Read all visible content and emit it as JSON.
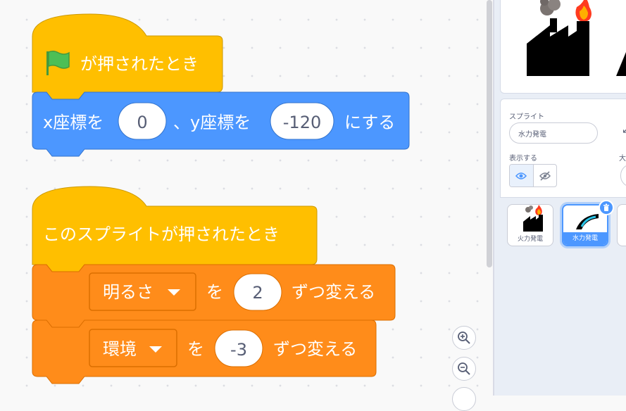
{
  "script1": {
    "hat_text": "が押されたとき",
    "goto_x_label": "x座標を",
    "x_value": "0",
    "goto_y_label": "、y座標を",
    "y_value": "-120",
    "goto_suffix": "にする"
  },
  "script2": {
    "hat_text": "このスプライトが押されたとき",
    "effect1_option": "明るさ",
    "effect1_joiner": "を",
    "effect1_value": "2",
    "effect1_suffix": "ずつ変える",
    "effect2_option": "環境",
    "effect2_joiner": "を",
    "effect2_value": "-3",
    "effect2_suffix": "ずつ変える"
  },
  "sprite_info": {
    "sprite_label": "スプライト",
    "name_value": "水力発電",
    "show_label": "表示する",
    "size_label_partial": "大"
  },
  "sprites": [
    {
      "name": "火力発電",
      "selected": false
    },
    {
      "name": "水力発電",
      "selected": true
    }
  ],
  "colors": {
    "events": "#ffbf00",
    "motion": "#4c97ff",
    "looks_orange": "#ff8c1a",
    "accent": "#4c97ff"
  },
  "icons": [
    "green-flag-icon",
    "dropdown-arrow-icon",
    "zoom-in-icon",
    "zoom-out-icon",
    "eye-icon",
    "eye-slash-icon",
    "trash-icon"
  ]
}
